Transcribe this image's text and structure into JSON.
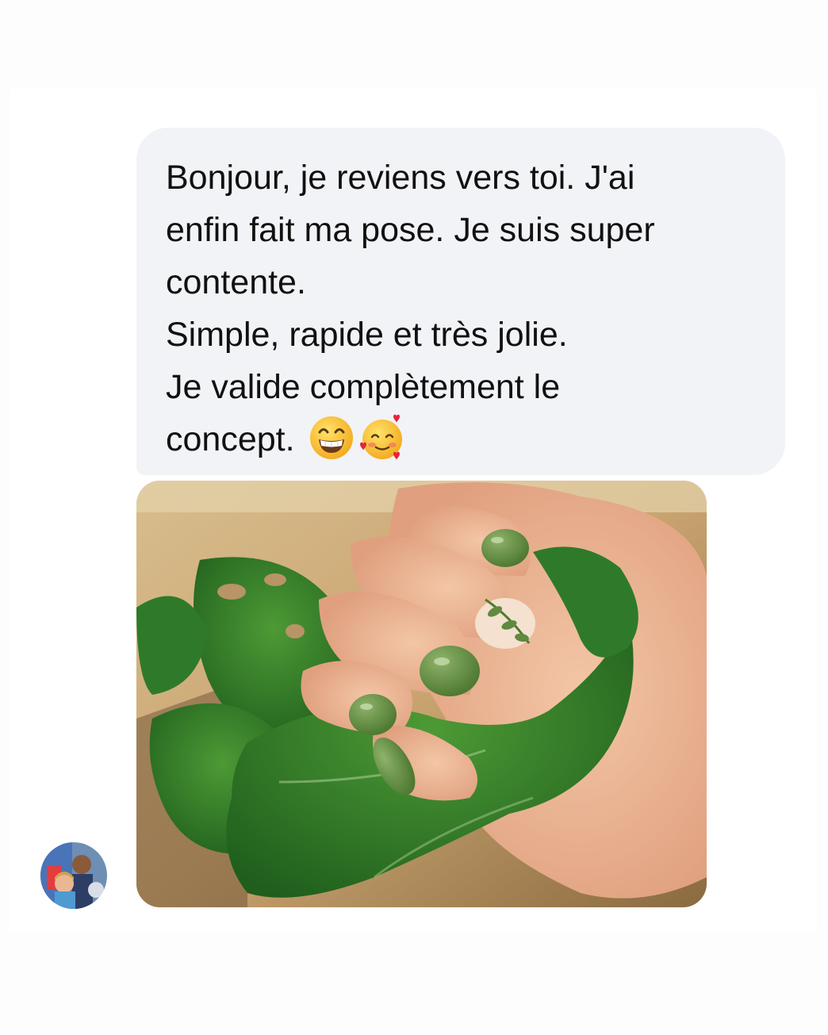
{
  "conversation": {
    "message": {
      "lines": [
        "Bonjour, je reviens vers toi. J'ai",
        "enfin fait ma pose. Je suis super",
        "contente.",
        "Simple, rapide et très jolie.",
        "Je valide complètement le",
        "concept."
      ],
      "emojis": [
        "beaming-face-icon",
        "smiling-face-with-hearts-icon"
      ]
    },
    "attachment": {
      "kind": "photo",
      "subject": "hand-with-green-nails-holding-leaves"
    },
    "sender": {
      "avatar_icon": "avatar"
    }
  },
  "colors": {
    "page_background": "#fdfdfd",
    "bubble_background": "#f2f3f6",
    "text": "#111111",
    "nail_green": "#5f8a3f",
    "leaf_green": "#2f7a2a"
  }
}
